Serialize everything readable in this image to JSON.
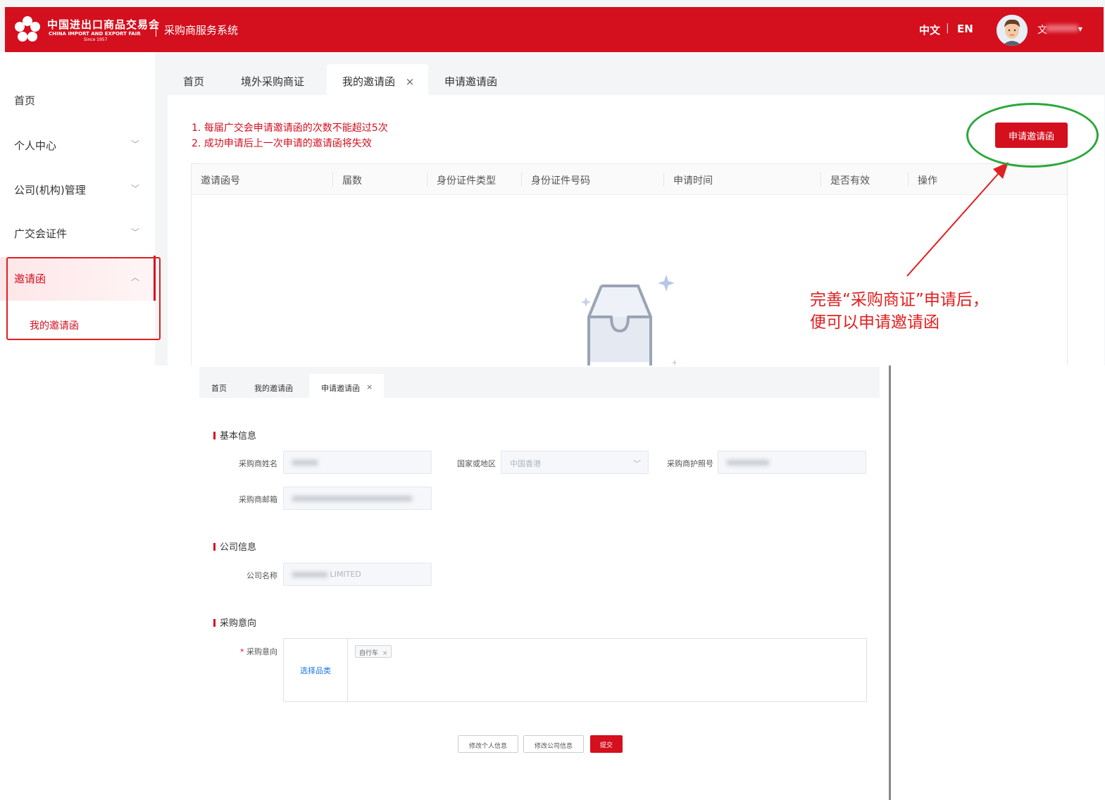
{
  "header": {
    "logo_cn": "中国进出口商品交易会",
    "logo_en": "CHINA IMPORT AND EXPORT FAIR",
    "logo_since": "Since 1957",
    "system_title": "采购商服务系统",
    "lang_zh": "中文",
    "lang_sep": "|",
    "lang_en": "EN",
    "user_name": "文",
    "user_caret": "▾",
    "brand_color": "#d40f1e"
  },
  "sidebar": {
    "items": [
      {
        "label": "首页",
        "chevron": ""
      },
      {
        "label": "个人中心",
        "chevron": "﹀"
      },
      {
        "label": "公司(机构)管理",
        "chevron": "﹀"
      },
      {
        "label": "广交会证件",
        "chevron": "﹀"
      },
      {
        "label": "邀请函",
        "chevron": "︿"
      }
    ],
    "sub_item": "我的邀请函"
  },
  "tabs": [
    {
      "label": "首页"
    },
    {
      "label": "境外采购商证"
    },
    {
      "label": "我的邀请函",
      "close": "×"
    },
    {
      "label": "申请邀请函"
    }
  ],
  "main": {
    "rules": [
      "1. 每届广交会申请邀请函的次数不能超过5次",
      "2. 成功申请后上一次申请的邀请函将失效"
    ],
    "apply_button": "申请邀请函",
    "table_headers": [
      "邀请函号",
      "届数",
      "身份证件类型",
      "身份证件号码",
      "申请时间",
      "是否有效",
      "操作"
    ],
    "empty_icon": "inbox-empty-icon"
  },
  "annotation": {
    "line1": "完善“采购商证”申请后，",
    "line2": "便可以申请邀请函",
    "color": "#e02020",
    "ring_color": "#2aa83a"
  },
  "form": {
    "tabs": [
      {
        "label": "首页"
      },
      {
        "label": "我的邀请函"
      },
      {
        "label": "申请邀请函",
        "close": "×"
      }
    ],
    "sections": {
      "basic": "基本信息",
      "company": "公司信息",
      "intent": "采购意向"
    },
    "fields": {
      "buyer_name_label": "采购商姓名",
      "country_label": "国家或地区",
      "country_value": "中国香港",
      "country_chevron": "﹀",
      "passport_label": "采购商护照号",
      "email_label": "采购商邮箱",
      "company_name_label": "公司名称",
      "company_name_value": "LIMITED",
      "intent_label": "采购意向",
      "required_mark": "*",
      "pick_category": "选择品类",
      "tag": "自行车",
      "tag_close": "×"
    },
    "buttons": {
      "edit_personal": "修改个人信息",
      "edit_company": "修改公司信息",
      "submit": "提交"
    }
  }
}
